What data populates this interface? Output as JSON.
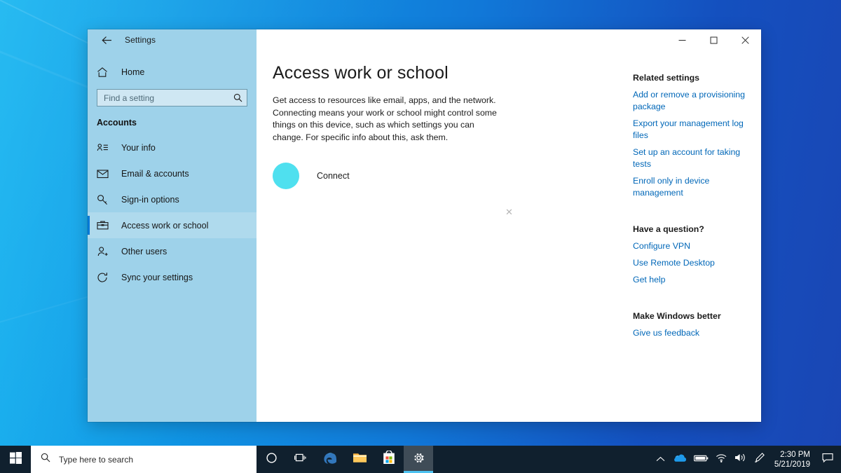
{
  "window": {
    "title": "Settings",
    "back_icon": "back-arrow-icon",
    "minimize_label": "─",
    "maximize_label": "□",
    "close_label": "✕"
  },
  "sidebar": {
    "home_label": "Home",
    "search": {
      "placeholder": "Find a setting",
      "value": "",
      "icon": "search-icon"
    },
    "group_title": "Accounts",
    "items": [
      {
        "label": "Your info",
        "icon": "contact-card-icon",
        "selected": false
      },
      {
        "label": "Email & accounts",
        "icon": "envelope-icon",
        "selected": false
      },
      {
        "label": "Sign-in options",
        "icon": "key-icon",
        "selected": false
      },
      {
        "label": "Access work or school",
        "icon": "briefcase-icon",
        "selected": true
      },
      {
        "label": "Other users",
        "icon": "person-add-icon",
        "selected": false
      },
      {
        "label": "Sync your settings",
        "icon": "sync-icon",
        "selected": false
      }
    ]
  },
  "main": {
    "page_title": "Access work or school",
    "description": "Get access to resources like email, apps, and the network. Connecting means your work or school might control some things on this device, such as which settings you can change. For specific info about this, ask them.",
    "connect_label": "Connect",
    "connect_highlight_color": "#4fe0ef",
    "x_marker": "✕"
  },
  "related": {
    "heading_1": "Related settings",
    "links_1": [
      "Add or remove a provisioning package",
      "Export your management log files",
      "Set up an account for taking tests",
      "Enroll only in device management"
    ],
    "heading_2": "Have a question?",
    "links_2": [
      "Configure VPN",
      "Use Remote Desktop",
      "Get help"
    ],
    "heading_3": "Make Windows better",
    "links_3": [
      "Give us feedback"
    ],
    "link_color": "#0067b8"
  },
  "taskbar": {
    "start_icon": "windows-logo-icon",
    "search": {
      "placeholder": "Type here to search",
      "icon": "search-icon"
    },
    "buttons": [
      {
        "name": "cortana-icon",
        "label": "Cortana",
        "active": false
      },
      {
        "name": "task-view-icon",
        "label": "Task View",
        "active": false
      },
      {
        "name": "edge-icon",
        "label": "Microsoft Edge",
        "active": false
      },
      {
        "name": "file-explorer-icon",
        "label": "File Explorer",
        "active": false
      },
      {
        "name": "microsoft-store-icon",
        "label": "Microsoft Store",
        "active": false
      },
      {
        "name": "settings-gear-icon",
        "label": "Settings",
        "active": true
      }
    ],
    "tray": [
      {
        "name": "show-hidden-icons-icon",
        "label": "Show hidden icons"
      },
      {
        "name": "onedrive-icon",
        "label": "OneDrive"
      },
      {
        "name": "battery-icon",
        "label": "Battery"
      },
      {
        "name": "wifi-icon",
        "label": "Network"
      },
      {
        "name": "volume-icon",
        "label": "Volume"
      },
      {
        "name": "pen-menu-icon",
        "label": "Windows Ink Workspace"
      }
    ],
    "clock": {
      "time": "2:30 PM",
      "date": "5/21/2019"
    },
    "action_center_icon": "notification-icon"
  }
}
